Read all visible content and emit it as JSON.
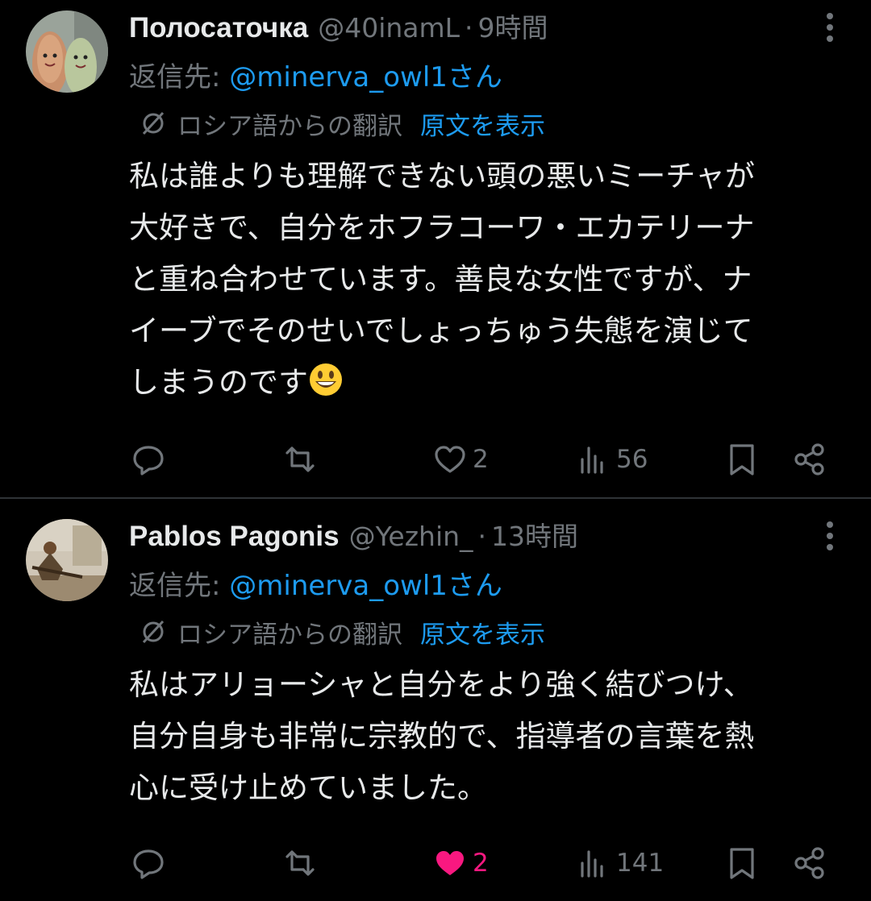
{
  "colors": {
    "background": "#000000",
    "text": "#e7e9ea",
    "secondary": "#71767b",
    "link": "#1d9bf0",
    "like_active": "#f91880",
    "divider": "#2f3336"
  },
  "tweets": [
    {
      "name": "Полосаточка",
      "handle": "@40inamL",
      "separator": "·",
      "time": "9時間",
      "reply_prefix": "返信先: ",
      "reply_mention": "@minerva_owl1さん",
      "translation_label": "ロシア語からの翻訳",
      "show_original": "原文を表示",
      "text": "私は誰よりも理解できない頭の悪いミーチャが\n大好きで、自分をホフラコーワ・エカテリーナ\nと重ね合わせています。善良な女性ですが、ナ\nイーブでそのせいでしょっちゅう失態を演じて\nしまうのです",
      "has_emoji": true,
      "emoji": "grinning-face",
      "likes": "2",
      "liked": false,
      "views": "56"
    },
    {
      "name": "Pablos Pagonis",
      "handle": "@Yezhin_",
      "separator": "·",
      "time": "13時間",
      "reply_prefix": "返信先: ",
      "reply_mention": "@minerva_owl1さん",
      "translation_label": "ロシア語からの翻訳",
      "show_original": "原文を表示",
      "text": "私はアリョーシャと自分をより強く結びつけ、\n自分自身も非常に宗教的で、指導者の言葉を熱\n心に受け止めていました。",
      "has_emoji": false,
      "likes": "2",
      "liked": true,
      "views": "141"
    }
  ]
}
